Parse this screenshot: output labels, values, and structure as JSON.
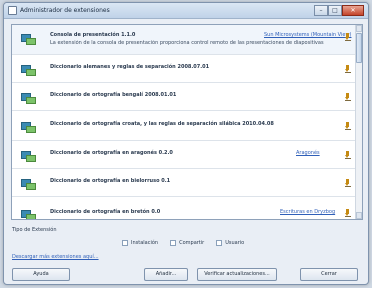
{
  "window": {
    "title": "Administrador de extensiones",
    "buttons": {
      "minimize": "–",
      "maximize": "□",
      "close": "✕"
    }
  },
  "extensions": [
    {
      "name": "Consola de presentación  1.1.0",
      "description": "La extensión de la consola de presentación proporciona control remoto de las presentaciones de diapositivas",
      "link": "Sun Microsystems (Mountain View)"
    },
    {
      "name": "Diccionario alemanes y reglas de separación  2008.07.01"
    },
    {
      "name": "Diccionario de ortografía bengalí  2008.01.01"
    },
    {
      "name": "Diccionario de ortografía croata, y las reglas de separación silábica  2010.04.08"
    },
    {
      "name": "Diccionario de ortografía en aragonés  0.2.0",
      "link": "Aragonés"
    },
    {
      "name": "Diccionario de ortografía en bielorruso  0.1"
    },
    {
      "name": "Diccionario de ortografía en bretón  0.0",
      "link": "Escrituras en Dryzbog"
    }
  ],
  "filters": {
    "label": "Tipo de Extensión",
    "options": [
      "Instalación",
      "Compartir",
      "Usuario"
    ]
  },
  "links": {
    "more": "Descargar más extensiones aquí..."
  },
  "buttons": {
    "help": "Ayuda",
    "add": "Añadir...",
    "check_updates": "Verificar actualizaciones...",
    "close": "Cerrar"
  }
}
